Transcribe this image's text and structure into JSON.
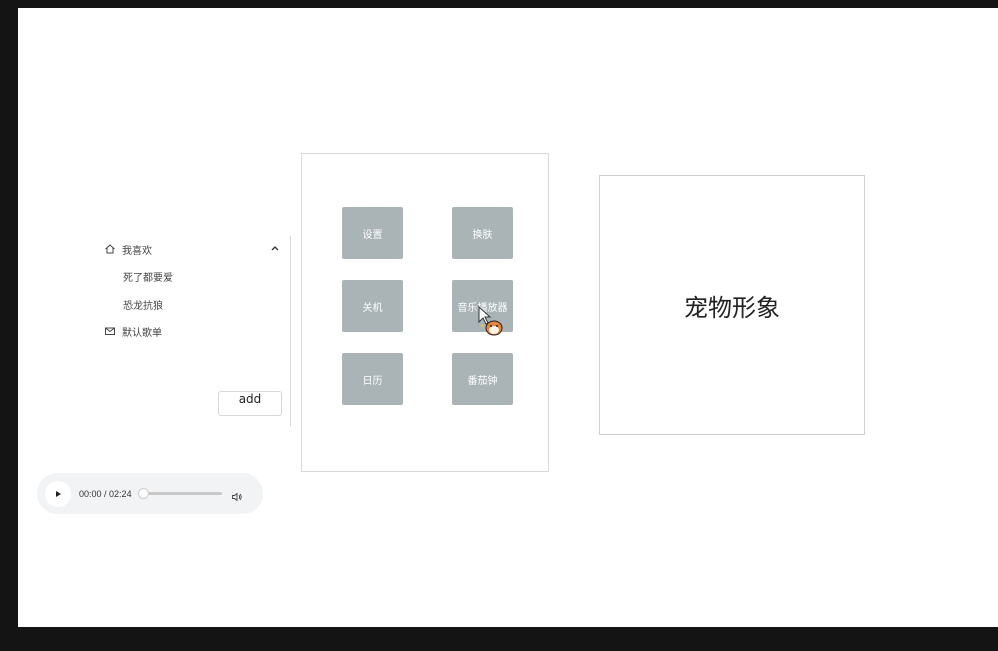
{
  "menu": {
    "items": [
      {
        "label": "我喜欢",
        "icon": "home-icon",
        "expanded": true
      },
      {
        "label": "死了都要爱",
        "icon": ""
      },
      {
        "label": "恐龙抗狼",
        "icon": ""
      },
      {
        "label": "默认歌单",
        "icon": "mail-icon"
      }
    ],
    "add_label": "add"
  },
  "player": {
    "current_time": "00:00",
    "duration": "/ 02:24",
    "progress": 0
  },
  "apps": [
    {
      "label": "设置"
    },
    {
      "label": "换肤"
    },
    {
      "label": "关机"
    },
    {
      "label": "音乐播放器"
    },
    {
      "label": "日历"
    },
    {
      "label": "番茄钟"
    }
  ],
  "pet": {
    "label": "宠物形象"
  },
  "bottom_bar": {
    "text": " "
  },
  "colors": {
    "app_button_bg": "#aab4b7",
    "window_bg": "#ffffff",
    "frame_bg": "#141414"
  }
}
